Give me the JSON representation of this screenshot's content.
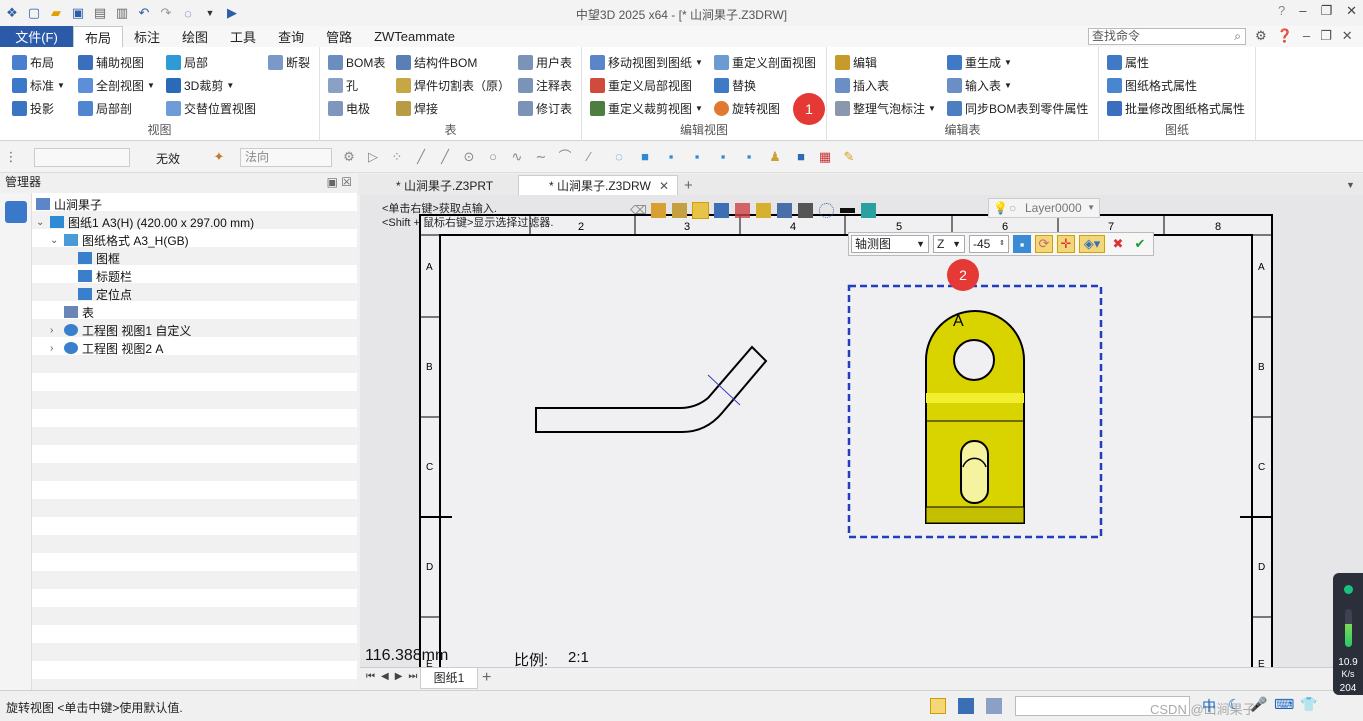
{
  "app": {
    "title": "中望3D 2025 x64 - [* 山涧果子.Z3DRW]"
  },
  "menu": {
    "file_label": "文件(F)",
    "tabs": [
      "布局",
      "标注",
      "绘图",
      "工具",
      "查询",
      "管路",
      "ZWTeammate"
    ],
    "search_placeholder": "查找命令"
  },
  "ribbon": {
    "view_group": {
      "label": "视图",
      "btn_layout": "布局",
      "btn_aux_view": "辅助视图",
      "btn_partial": "局部",
      "btn_break": "断裂",
      "btn_standard": "标准",
      "btn_full_section": "全剖视图",
      "btn_3d_crop": "3D裁剪",
      "btn_projection": "投影",
      "btn_partial_section": "局部剖",
      "btn_alt_position": "交替位置视图"
    },
    "table_group": {
      "label": "表",
      "btn_bom": "BOM表",
      "btn_struct_bom": "结构件BOM",
      "btn_user_table": "用户表",
      "btn_hole": "孔",
      "btn_weld_cut": "焊件切割表（原）",
      "btn_note_table": "注释表",
      "btn_electrode": "电极",
      "btn_weld": "焊接",
      "btn_revision": "修订表"
    },
    "edit_view_group": {
      "label": "编辑视图",
      "btn_move_view": "移动视图到图纸",
      "btn_redefine_section": "重定义剖面视图",
      "btn_redefine_partial": "重定义局部视图",
      "btn_replace": "替换",
      "btn_redefine_crop": "重定义裁剪视图",
      "btn_rotate_view": "旋转视图"
    },
    "edit_table_group": {
      "label": "编辑表",
      "btn_edit": "编辑",
      "btn_regenerate": "重生成",
      "btn_insert_table": "插入表",
      "btn_input_table": "输入表",
      "btn_arrange_bubble": "整理气泡标注",
      "btn_sync_bom": "同步BOM表到零件属性"
    },
    "sheet_group": {
      "label": "图纸",
      "btn_properties": "属性",
      "btn_format_props": "图纸格式属性",
      "btn_batch_format": "批量修改图纸格式属性"
    },
    "badge1": "1",
    "badge2": "2"
  },
  "toolbar2": {
    "invalid_label": "无效",
    "normal_combo": "法向"
  },
  "manager": {
    "title": "管理器",
    "tree": [
      {
        "label": "山涧果子",
        "level": 0,
        "expander": ""
      },
      {
        "label": "图纸1 A3(H) (420.00 x 297.00 mm)",
        "level": 0,
        "expander": "v"
      },
      {
        "label": "图纸格式 A3_H(GB)",
        "level": 1,
        "expander": "v"
      },
      {
        "label": "图框",
        "level": 2,
        "expander": ""
      },
      {
        "label": "标题栏",
        "level": 2,
        "expander": ""
      },
      {
        "label": "定位点",
        "level": 2,
        "expander": ""
      },
      {
        "label": "表",
        "level": 1,
        "expander": ""
      },
      {
        "label": "工程图 视图1 自定义",
        "level": 1,
        "expander": ">"
      },
      {
        "label": "工程图 视图2 A",
        "level": 1,
        "expander": ">"
      }
    ]
  },
  "doc_tabs": [
    "* 山涧果子.Z3PRT",
    "* 山涧果子.Z3DRW"
  ],
  "canvas": {
    "hint1": "<单击右键>获取点输入.",
    "hint2": "<Shift + 鼠标右键>显示选择过滤器.",
    "layer": "Layer0000",
    "view_combo": "轴测图",
    "axis_combo": "Z",
    "angle_value": "-45",
    "ruler_top": [
      "2",
      "3",
      "4",
      "5",
      "6",
      "7",
      "8"
    ],
    "ruler_side": [
      "A",
      "B",
      "C",
      "D",
      "E"
    ],
    "view_label": "A",
    "measure": "116.388mm",
    "scale_label": "比例:",
    "scale_value": "2:1"
  },
  "sheet_tabs": [
    "图纸1"
  ],
  "status": {
    "text": "旋转视图  <单击中键>使用默认值.",
    "ime_zh": "中",
    "watermark": "CSDN @山涧果子"
  },
  "speed_widget": {
    "value": "10.9",
    "unit": "K/s",
    "second": "204"
  },
  "colors": {
    "accent": "#2b5aa8",
    "badge": "#e53935",
    "part_fill": "#d9d400",
    "selection": "#1f3fbf"
  }
}
